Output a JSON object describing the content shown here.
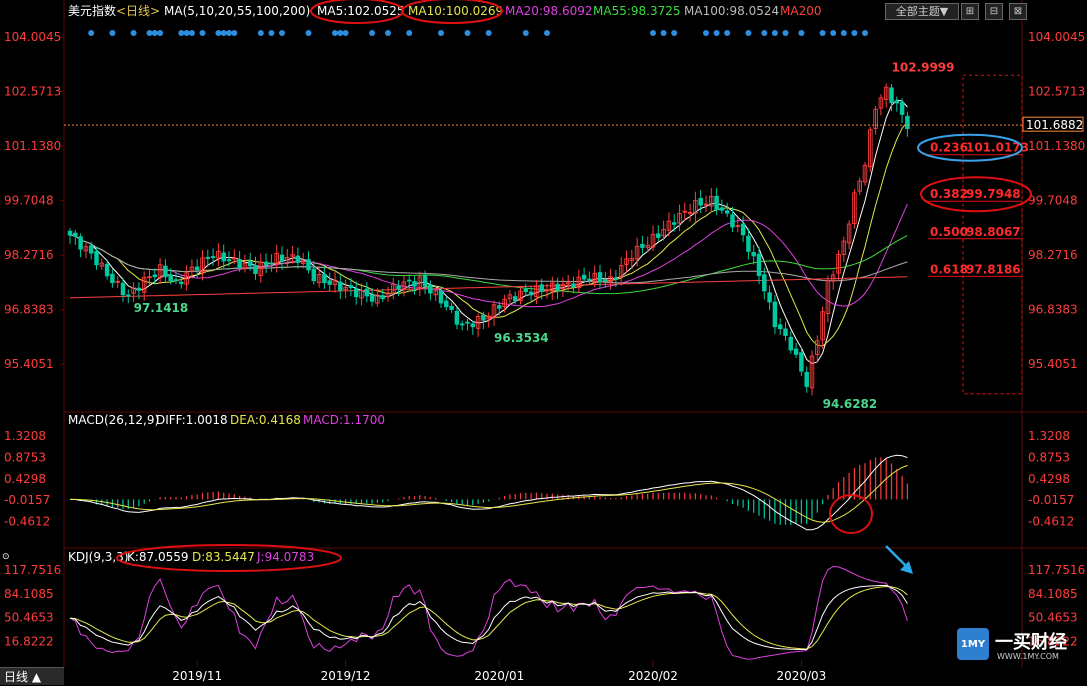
{
  "header": {
    "symbol": "美元指数",
    "period": "<日线>",
    "ma_label": "MA(5,10,20,55,100,200)",
    "ma5": "MA5:102.0525",
    "ma10": "MA10:100.0269",
    "ma20": "MA20:98.6092",
    "ma55": "MA55:98.3725",
    "ma100": "MA100:98.0524",
    "ma200": "MA200",
    "theme_button": "全部主题▼",
    "win_buttons": [
      "⊞",
      "⊟",
      "⊠"
    ]
  },
  "macd_header": {
    "name": "MACD(26,12,9)",
    "diff": "DIFF:1.0018",
    "dea": "DEA:0.4168",
    "macd": "MACD:1.1700"
  },
  "kdj_header": {
    "name": "KDJ(9,3,3)",
    "k": "K:87.0559",
    "d": "D:83.5447",
    "j": "J:94.0783"
  },
  "bottom_tab": "日线 ▲",
  "logo": {
    "mark": "1MY",
    "name": "一买财经",
    "url": "WWW.1MY.COM"
  },
  "chart_data": {
    "type": "candlestick",
    "main_axis": {
      "ticks": [
        104.0045,
        102.5713,
        101.138,
        99.7048,
        98.2716,
        96.8383,
        95.4051
      ],
      "tick_labels": [
        "104.0045",
        "102.5713",
        "101.1380",
        "99.7048",
        "98.2716",
        "96.8383",
        "95.4051"
      ],
      "ylim": [
        94.28,
        104.4
      ]
    },
    "x_labels": [
      "2019/11",
      "2019/12",
      "2020/01",
      "2020/02",
      "2020/03"
    ],
    "current_price": 101.6882,
    "current_price_label": "101.6882",
    "annotations": [
      {
        "text": "102.9999",
        "value": 102.9999
      },
      {
        "text": "97.1418",
        "value": 97.1418
      },
      {
        "text": "96.3534",
        "value": 96.3534
      },
      {
        "text": "94.6282",
        "value": 94.6282
      }
    ],
    "fibonacci": [
      {
        "ratio": "0.236",
        "price": "101.0173",
        "value": 101.0173
      },
      {
        "ratio": "0.382",
        "price": "99.7948",
        "value": 99.7948
      },
      {
        "ratio": "0.500",
        "price": "98.8067",
        "value": 98.8067
      },
      {
        "ratio": "0.618",
        "price": "97.8186",
        "value": 97.8186
      }
    ],
    "macd_axis": {
      "ticks": [
        1.3208,
        0.8753,
        0.4298,
        -0.0157,
        -0.4612
      ],
      "tick_labels": [
        "1.3208",
        "0.8753",
        "0.4298",
        "-0.0157",
        "-0.4612"
      ],
      "ylim": [
        -0.95,
        1.55
      ]
    },
    "kdj_axis": {
      "ticks": [
        117.7516,
        84.1085,
        50.4653,
        16.8222
      ],
      "tick_labels": [
        "117.7516",
        "84.1085",
        "50.4653",
        "16.8222"
      ],
      "ylim": [
        -15,
        135
      ]
    },
    "colors": {
      "up": "#ff3c3c",
      "down": "#00c8a0",
      "ma5": "#ffffff",
      "ma10": "#e6e64b",
      "ma20": "#e040e0",
      "ma55": "#3cdc3c",
      "ma100": "#aaaaaa",
      "ma200": "#ff4040",
      "highlight": "#e01010",
      "blue_ring": "#3aa0e8"
    },
    "close_waypoints": [
      [
        0,
        98.8
      ],
      [
        4,
        98.3
      ],
      [
        8,
        97.6
      ],
      [
        11,
        97.2
      ],
      [
        14,
        97.6
      ],
      [
        17,
        97.9
      ],
      [
        20,
        97.5
      ],
      [
        23,
        97.9
      ],
      [
        27,
        98.3
      ],
      [
        31,
        98.1
      ],
      [
        35,
        97.9
      ],
      [
        39,
        98.2
      ],
      [
        43,
        98.2
      ],
      [
        46,
        97.7
      ],
      [
        50,
        97.5
      ],
      [
        54,
        97.3
      ],
      [
        58,
        97.1
      ],
      [
        62,
        97.5
      ],
      [
        66,
        97.6
      ],
      [
        70,
        97.1
      ],
      [
        74,
        96.4
      ],
      [
        78,
        96.6
      ],
      [
        82,
        97.1
      ],
      [
        86,
        97.3
      ],
      [
        90,
        97.4
      ],
      [
        94,
        97.5
      ],
      [
        98,
        97.7
      ],
      [
        102,
        97.6
      ],
      [
        106,
        98.3
      ],
      [
        110,
        98.7
      ],
      [
        114,
        99.2
      ],
      [
        118,
        99.6
      ],
      [
        121,
        99.7
      ],
      [
        124,
        99.3
      ],
      [
        127,
        98.8
      ],
      [
        130,
        97.8
      ],
      [
        133,
        96.5
      ],
      [
        136,
        95.9
      ],
      [
        139,
        94.9
      ],
      [
        141,
        96.1
      ],
      [
        143,
        97.5
      ],
      [
        146,
        98.6
      ],
      [
        148,
        99.8
      ],
      [
        150,
        100.7
      ],
      [
        152,
        102.2
      ],
      [
        154,
        102.6
      ],
      [
        156,
        102.2
      ],
      [
        158,
        101.7
      ]
    ]
  }
}
